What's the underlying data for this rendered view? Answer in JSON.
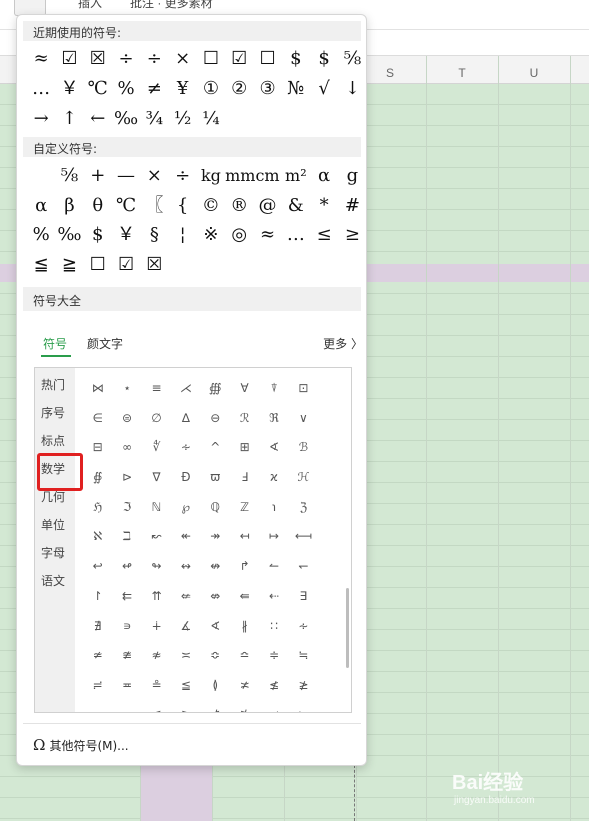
{
  "toolbar": {
    "symbol_tab": "符号",
    "tab_a": "插入",
    "tab_b": "批注 · 更多素材"
  },
  "columns": [
    "S",
    "T",
    "U"
  ],
  "watermark": {
    "main": "Bai经验",
    "sub": "jingyan.baidu.com"
  },
  "popup": {
    "recent_title": "近期使用的符号:",
    "recent_rows": [
      [
        "≈",
        "☑",
        "☒",
        "÷",
        "÷",
        "×",
        "☐",
        "☑",
        "☐",
        "$",
        "$",
        "⅝"
      ],
      [
        "…",
        "￥",
        "℃",
        "%",
        "≠",
        "¥",
        "①",
        "②",
        "③",
        "№",
        "√",
        "↓"
      ],
      [
        "→",
        "↑",
        "←",
        "‰",
        "¾",
        "½",
        "¼"
      ]
    ],
    "custom_title": "自定义符号:",
    "custom_rows": [
      [
        "",
        "⅝",
        "+",
        "—",
        "×",
        "÷",
        "kg",
        "mm",
        "cm",
        "m²",
        "α",
        "g"
      ],
      [
        "α",
        "β",
        "θ",
        "℃",
        "〖",
        "{",
        "©",
        "®",
        "@",
        "&",
        "*",
        "#"
      ],
      [
        "%",
        "‰",
        "$",
        "￥",
        "§",
        "¦",
        "※",
        "◎",
        "≈",
        "…",
        "≤",
        "≥"
      ],
      [
        "≦",
        "≧",
        "☐",
        "☑",
        "☒"
      ]
    ],
    "all_title": "符号大全",
    "tabs": {
      "symbols": "符号",
      "emoticons": "颜文字",
      "more": "更多 〉"
    },
    "categories": [
      "热门",
      "序号",
      "标点",
      "数学",
      "几何",
      "单位",
      "字母",
      "语文"
    ],
    "grid": [
      [
        "⋈",
        "⋆",
        "≡",
        "⋌",
        "∰",
        "∀",
        "⍒",
        "⊡",
        "",
        "",
        ""
      ],
      [
        "∈",
        "⊜",
        "∅",
        "∆",
        "⊖",
        "ℛ",
        "ℜ",
        "∨",
        "",
        "",
        ""
      ],
      [
        "⊟",
        "∞",
        "∜",
        "∻",
        "^",
        "⊞",
        "∢",
        "ℬ",
        "",
        "",
        ""
      ],
      [
        "∯",
        "⊳",
        "∇",
        "Ð",
        "ϖ",
        "Ⅎ",
        "ϰ",
        "ℋ",
        "",
        "",
        ""
      ],
      [
        "ℌ",
        "ℑ",
        "ℕ",
        "℘",
        "ℚ",
        "ℤ",
        "℩",
        "ℨ",
        "",
        "",
        ""
      ],
      [
        "ℵ",
        "ℶ",
        "↜",
        "↞",
        "↠",
        "↤",
        "↦",
        "⟻",
        "",
        "",
        ""
      ],
      [
        "↩",
        "↫",
        "↬",
        "↭",
        "↮",
        "↱",
        "↼",
        "↽",
        "",
        "",
        ""
      ],
      [
        "↾",
        "⇇",
        "⇈",
        "⇍",
        "⇎",
        "⇚",
        "⇠",
        "∃",
        "",
        "",
        ""
      ],
      [
        "∄",
        "∍",
        "∔",
        "∡",
        "∢",
        "∦",
        "∷",
        "∻",
        "",
        "",
        ""
      ],
      [
        "≄",
        "≇",
        "≉",
        "≍",
        "≎",
        "≏",
        "≑",
        "≒",
        "",
        "",
        ""
      ],
      [
        "≓",
        "≖",
        "≗",
        "≦",
        "≬",
        "≭",
        "≰",
        "≱",
        "",
        "",
        ""
      ],
      [
        "≲",
        "≳",
        "≶",
        "≷",
        "≸",
        "≹",
        "≺",
        "≻",
        "",
        "",
        ""
      ]
    ],
    "footer": "其他符号(M)...",
    "footer_icon": "omega-icon"
  }
}
